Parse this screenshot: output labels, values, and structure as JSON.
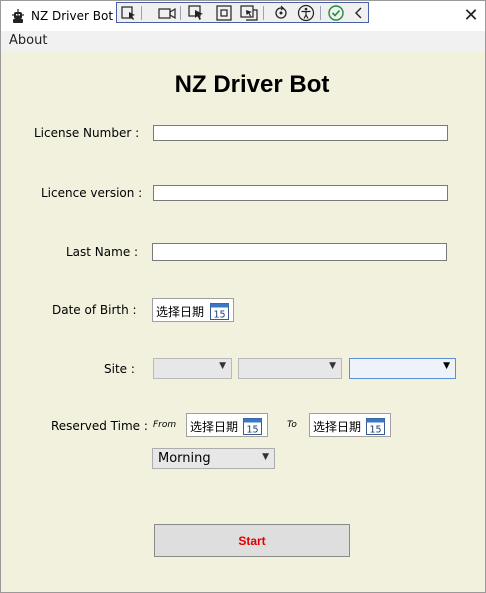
{
  "window": {
    "title": "NZ Driver Bot",
    "close_glyph": "✕"
  },
  "toolbar": {
    "icons": [
      "select-element-icon",
      "camera-icon",
      "pointer-icon",
      "box-icon",
      "track-focus-icon",
      "hot-reload-icon",
      "accessibility-icon",
      "check-icon",
      "collapse-icon"
    ]
  },
  "menu": {
    "items": [
      {
        "label": "About"
      }
    ]
  },
  "heading": "NZ Driver Bot",
  "form": {
    "license_number": {
      "label": "License Number :",
      "value": ""
    },
    "licence_version": {
      "label": "Licence version :",
      "value": ""
    },
    "last_name": {
      "label": "Last Name :",
      "value": ""
    },
    "dob": {
      "label": "Date of Birth :",
      "placeholder": "选择日期"
    },
    "site": {
      "label": "Site :",
      "values": [
        "",
        "",
        ""
      ]
    },
    "reserved_time": {
      "label": "Reserved Time :",
      "from_label": "From",
      "to_label": "To",
      "from_placeholder": "选择日期",
      "to_placeholder": "选择日期",
      "slot": "Morning"
    }
  },
  "calendar_day": "15",
  "start_label": "Start",
  "colors": {
    "background": "#f1f1dd",
    "start_text": "#e00000",
    "heading": "#000000"
  }
}
